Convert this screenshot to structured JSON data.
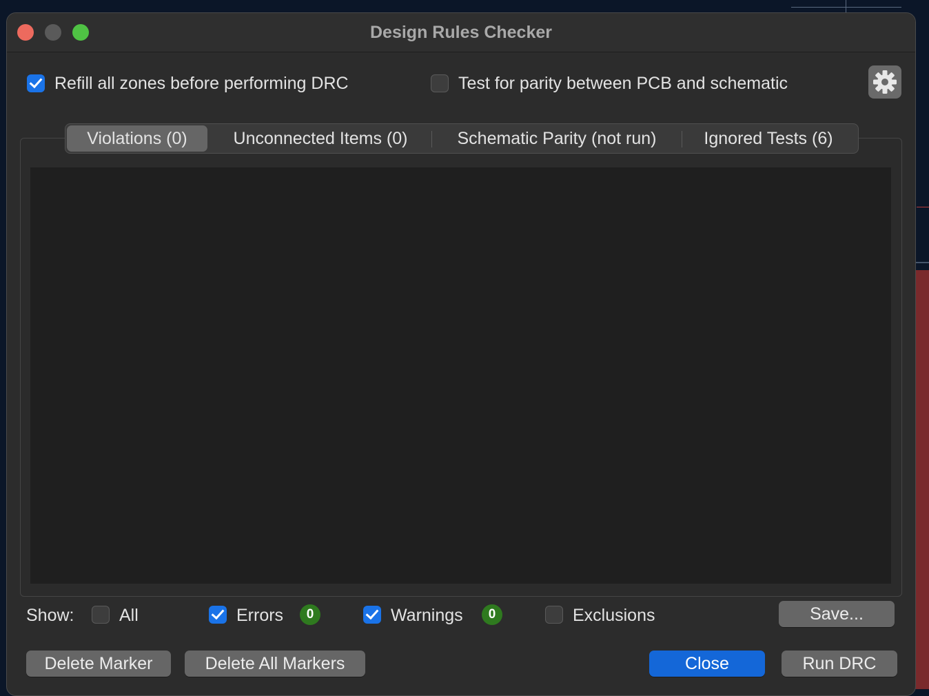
{
  "window": {
    "title": "Design Rules Checker"
  },
  "options": {
    "refill_zones": {
      "label": "Refill all zones before performing DRC",
      "checked": true
    },
    "test_parity": {
      "label": "Test for parity between PCB and schematic",
      "checked": false
    }
  },
  "tabs": [
    {
      "label": "Violations (0)",
      "active": true
    },
    {
      "label": "Unconnected Items (0)",
      "active": false
    },
    {
      "label": "Schematic Parity (not run)",
      "active": false
    },
    {
      "label": "Ignored Tests (6)",
      "active": false
    }
  ],
  "filters": {
    "show_label": "Show:",
    "all": {
      "label": "All",
      "checked": false
    },
    "errors": {
      "label": "Errors",
      "checked": true,
      "count": "0"
    },
    "warnings": {
      "label": "Warnings",
      "checked": true,
      "count": "0"
    },
    "exclusions": {
      "label": "Exclusions",
      "checked": false
    }
  },
  "buttons": {
    "save": "Save...",
    "delete_marker": "Delete Marker",
    "delete_all_markers": "Delete All Markers",
    "close": "Close",
    "run_drc": "Run DRC"
  },
  "colors": {
    "accent": "#1467d8",
    "badge": "#2f7a1f",
    "window_bg": "#2c2c2c"
  }
}
